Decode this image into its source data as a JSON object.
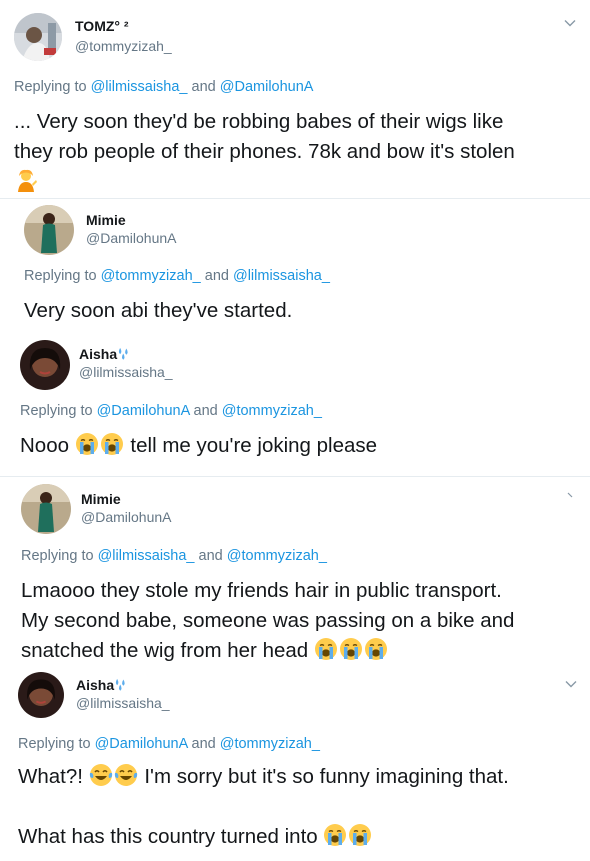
{
  "t1": {
    "name": "TOMZ° ²",
    "handle": "@tommyzizah_",
    "replying_prefix": "Replying to",
    "mention_a": "@lilmissaisha_",
    "and": "and",
    "mention_b": "@DamilohunA",
    "line1": "... Very soon they'd be robbing babes of their wigs like",
    "line2": "they rob people of their phones. 78k and bow it's stolen"
  },
  "t2": {
    "name": "Mimie",
    "handle": "@DamilohunA",
    "replying_prefix": "Replying to",
    "mention_a": "@tommyzizah_",
    "and": "and",
    "mention_b": "@lilmissaisha_",
    "line1": "Very soon abi they've started."
  },
  "t3": {
    "name": "Aisha",
    "handle": "@lilmissaisha_",
    "replying_prefix": "Replying to",
    "mention_a": "@DamilohunA",
    "and": "and",
    "mention_b": "@tommyzizah_",
    "line1a": "Nooo",
    "line1b": "tell me you're joking please"
  },
  "t4": {
    "name": "Mimie",
    "handle": "@DamilohunA",
    "replying_prefix": "Replying to",
    "mention_a": "@lilmissaisha_",
    "and": "and",
    "mention_b": "@tommyzizah_",
    "line1": "Lmaooo they stole my friends hair in public transport.",
    "line2": "My second babe, someone was passing on a bike and",
    "line3": "snatched the wig from her head"
  },
  "t5": {
    "name": "Aisha",
    "handle": "@lilmissaisha_",
    "replying_prefix": "Replying to",
    "mention_a": "@DamilohunA",
    "and": "and",
    "mention_b": "@tommyzizah_",
    "line1a": "What?!",
    "line1b": "I'm sorry but it's so funny imagining that.",
    "line2": "What has this country turned into"
  },
  "icons": {
    "chevron": "chevron-down-icon",
    "emoji_shrug": "person-tipping-hand-emoji",
    "emoji_cry": "loudly-crying-face-emoji",
    "emoji_joy": "face-with-tears-of-joy-emoji",
    "emoji_sweat": "sweat-droplets-emoji"
  },
  "colors": {
    "link": "#1b95e0",
    "secondary": "#657786",
    "text": "#14171a"
  }
}
